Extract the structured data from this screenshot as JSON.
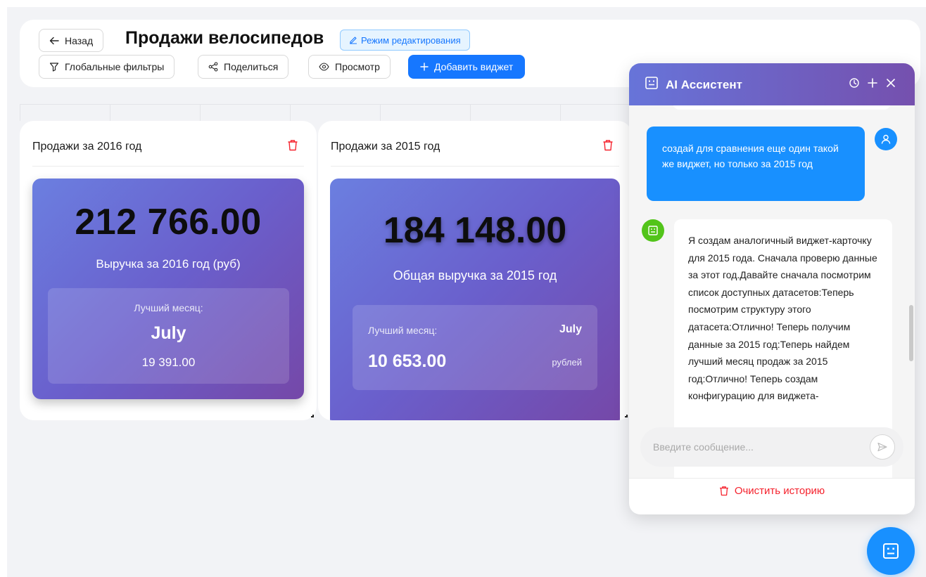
{
  "header": {
    "back_label": "Назад",
    "title": "Продажи велосипедов",
    "edit_mode_label": "Режим редактирования",
    "global_filters_label": "Глобальные фильтры",
    "share_label": "Поделиться",
    "view_label": "Просмотр",
    "add_widget_label": "Добавить виджет"
  },
  "widgets": [
    {
      "title": "Продажи за 2016 год",
      "value": "212 766.00",
      "caption": "Выручка за 2016 год (руб)",
      "best_label": "Лучший месяц:",
      "best_month": "July",
      "best_amount": "19 391.00"
    },
    {
      "title": "Продажи за 2015 год",
      "value": "184 148.00",
      "caption": "Общая выручка за 2015 год",
      "best_label": "Лучший месяц:",
      "best_month": "July",
      "best_amount": "10 653.00",
      "best_unit": "рублей"
    }
  ],
  "assistant": {
    "title": "AI Ассистент",
    "user_message": "создай для сравнения еще один такой же виджет, но только за 2015 год",
    "bot_message": "Я создам аналогичный виджет-карточку для 2015 года. Сначала проверю данные за этот год.Давайте сначала посмотрим список доступных датасетов:Теперь посмотрим структуру этого датасета:Отлично! Теперь получим данные за 2015 год:Теперь найдем лучший месяц продаж за 2015 год:Отлично! Теперь создам конфигурацию для виджета-",
    "input_placeholder": "Введите сообщение...",
    "clear_label": "Очистить историю"
  },
  "colors": {
    "primary": "#1677ff",
    "danger": "#f5222d",
    "bot_avatar": "#52c41a",
    "kpi_gradient_start": "#6b7fe0",
    "kpi_gradient_end": "#7548a8"
  }
}
